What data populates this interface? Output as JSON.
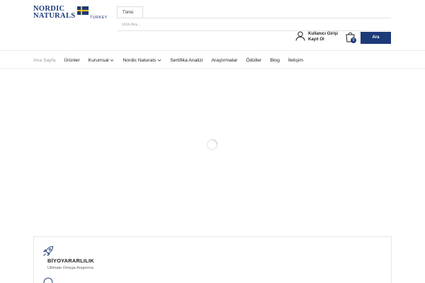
{
  "header": {
    "logo": {
      "line1": "NORDIC",
      "line2": "NATURALS",
      "region": "TURKEY"
    },
    "search": {
      "category_label": "Tümü",
      "placeholder": "Ürün Ara...",
      "button_label": "Ara"
    },
    "account": {
      "login_label": "Kullanıcı Girişi",
      "register_label": "Kayıt Ol"
    },
    "cart": {
      "count": "0"
    }
  },
  "nav": {
    "items": [
      {
        "label": "Ana Sayfa",
        "active": true,
        "dropdown": false
      },
      {
        "label": "Ürünler",
        "active": false,
        "dropdown": false
      },
      {
        "label": "Kurumsal",
        "active": false,
        "dropdown": true
      },
      {
        "label": "Nordic Naturals",
        "active": false,
        "dropdown": true
      },
      {
        "label": "Sertifika Analizi",
        "active": false,
        "dropdown": false
      },
      {
        "label": "Araştırmalar",
        "active": false,
        "dropdown": false
      },
      {
        "label": "Ödüller",
        "active": false,
        "dropdown": false
      },
      {
        "label": "Blog",
        "active": false,
        "dropdown": false
      },
      {
        "label": "İletişim",
        "active": false,
        "dropdown": false
      }
    ]
  },
  "feature": {
    "title": "BİYOYARARLILIK",
    "subtitle": "Ultimate Omega Araştırma"
  },
  "colors": {
    "brand": "#1d3a78",
    "accent_gold": "#f2c21b",
    "muted_text": "#9a9a9a"
  },
  "icons": {
    "user": "user-icon",
    "cart": "cart-icon",
    "rocket": "rocket-icon",
    "chevron": "chevron-down-icon",
    "loader": "spinner-icon"
  }
}
